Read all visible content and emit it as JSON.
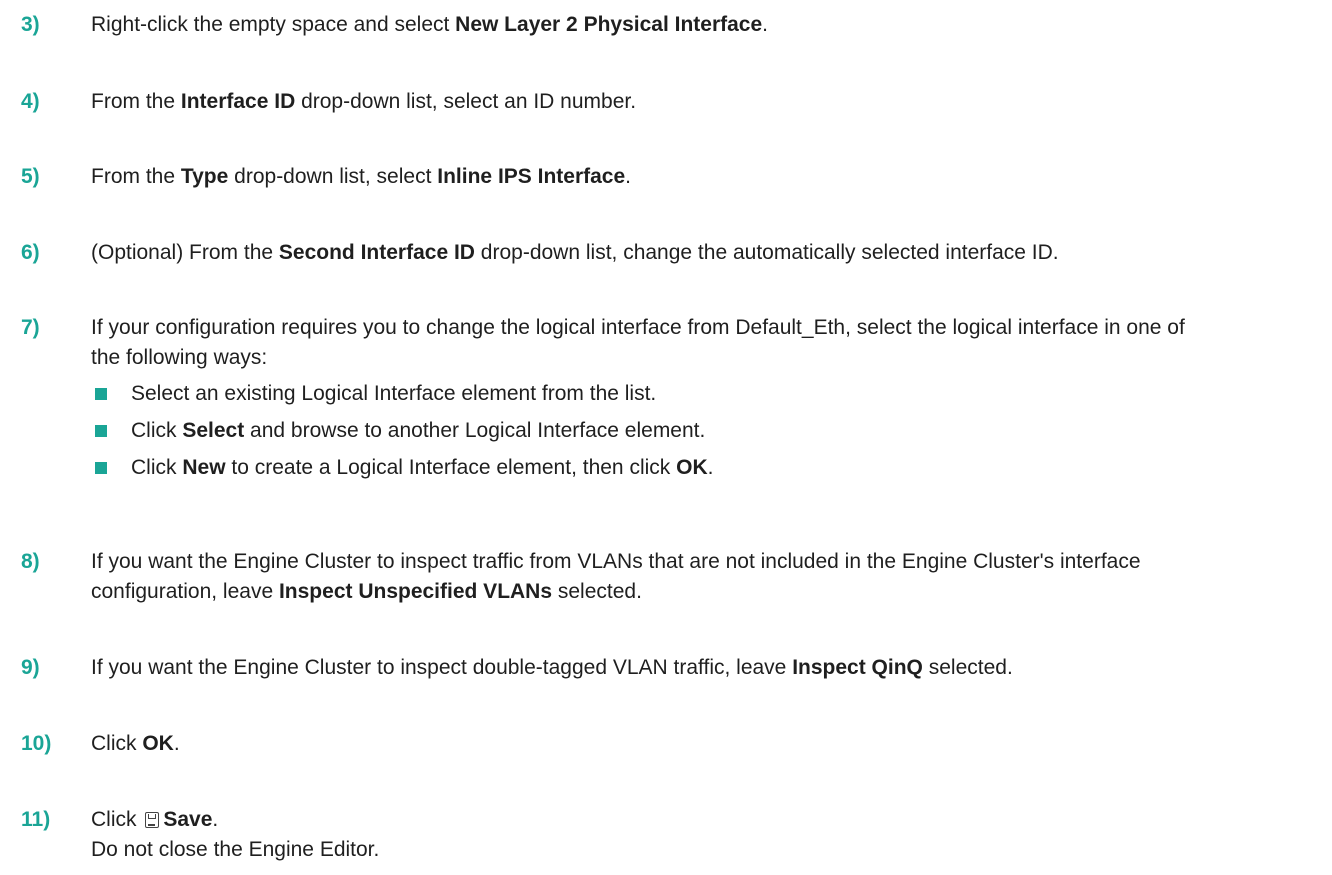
{
  "colors": {
    "step_number": "#1aa596",
    "bullet": "#1aa596",
    "text": "#1f1f1f"
  },
  "steps": [
    {
      "number": "3)",
      "text": [
        {
          "t": "Right-click the empty space and select "
        },
        {
          "t": "New Layer 2 Physical Interface",
          "b": true
        },
        {
          "t": "."
        }
      ]
    },
    {
      "number": "4)",
      "text": [
        {
          "t": "From the "
        },
        {
          "t": "Interface ID",
          "b": true
        },
        {
          "t": " drop-down list, select an ID number."
        }
      ]
    },
    {
      "number": "5)",
      "text": [
        {
          "t": "From the "
        },
        {
          "t": "Type",
          "b": true
        },
        {
          "t": " drop-down list, select "
        },
        {
          "t": "Inline IPS Interface",
          "b": true
        },
        {
          "t": "."
        }
      ]
    },
    {
      "number": "6)",
      "text": [
        {
          "t": "(Optional) From the "
        },
        {
          "t": "Second Interface ID",
          "b": true
        },
        {
          "t": " drop-down list, change the automatically selected interface ID."
        }
      ]
    },
    {
      "number": "7)",
      "text": [
        {
          "t": "If your configuration requires you to change the logical interface from Default_Eth, select the logical interface in one of the following ways:"
        }
      ],
      "bullets": [
        [
          {
            "t": "Select an existing Logical Interface element from the list."
          }
        ],
        [
          {
            "t": "Click "
          },
          {
            "t": "Select",
            "b": true
          },
          {
            "t": " and browse to another Logical Interface element."
          }
        ],
        [
          {
            "t": "Click "
          },
          {
            "t": "New",
            "b": true
          },
          {
            "t": " to create a Logical Interface element, then click "
          },
          {
            "t": "OK",
            "b": true
          },
          {
            "t": "."
          }
        ]
      ]
    },
    {
      "number": "8)",
      "text": [
        {
          "t": "If you want the Engine Cluster to inspect traffic from VLANs that are not included in the Engine Cluster's interface configuration, leave "
        },
        {
          "t": "Inspect Unspecified VLANs",
          "b": true
        },
        {
          "t": " selected."
        }
      ]
    },
    {
      "number": "9)",
      "text": [
        {
          "t": "If you want the Engine Cluster to inspect double-tagged VLAN traffic, leave "
        },
        {
          "t": "Inspect QinQ",
          "b": true
        },
        {
          "t": " selected."
        }
      ]
    },
    {
      "number": "10)",
      "text": [
        {
          "t": "Click "
        },
        {
          "t": "OK",
          "b": true
        },
        {
          "t": "."
        }
      ]
    },
    {
      "number": "11)",
      "text": [
        {
          "t": "Click "
        },
        {
          "icon": "save-icon"
        },
        {
          "t": "Save",
          "b": true
        },
        {
          "t": "."
        }
      ],
      "note": "Do not close the Engine Editor."
    }
  ]
}
